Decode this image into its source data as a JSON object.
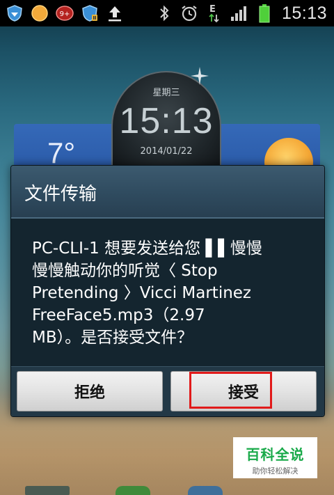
{
  "status_bar": {
    "time": "15:13",
    "notification_badge": "9+",
    "network_label": "E",
    "icons": [
      "shield-wifi-icon",
      "sun-icon",
      "notification-badge-icon",
      "shield-pause-icon",
      "upload-icon",
      "bluetooth-icon",
      "alarm-icon",
      "data-e-icon",
      "signal-icon",
      "battery-icon"
    ]
  },
  "clock_widget": {
    "weekday": "星期三",
    "time": "15:13",
    "date": "2014/01/22"
  },
  "weather_widget": {
    "temperature": "7°"
  },
  "dialog": {
    "title": "文件传输",
    "message_lines": [
      "PC-CLI-1 想要发送给您 ▌▌慢慢",
      "慢慢触动你的听觉〈 Stop",
      "Pretending 〉Vicci Martinez",
      "FreeFace5.mp3（2.97",
      "MB）。是否接受文件？"
    ],
    "buttons": {
      "reject": "拒绝",
      "accept": "接受"
    }
  },
  "watermark": {
    "title": "百科全说",
    "subtitle": "助你轻松解决"
  },
  "colors": {
    "highlight": "#e11a1a",
    "dialog_title_bg": "#2f4b5f",
    "dialog_body_bg": "#14252f"
  }
}
